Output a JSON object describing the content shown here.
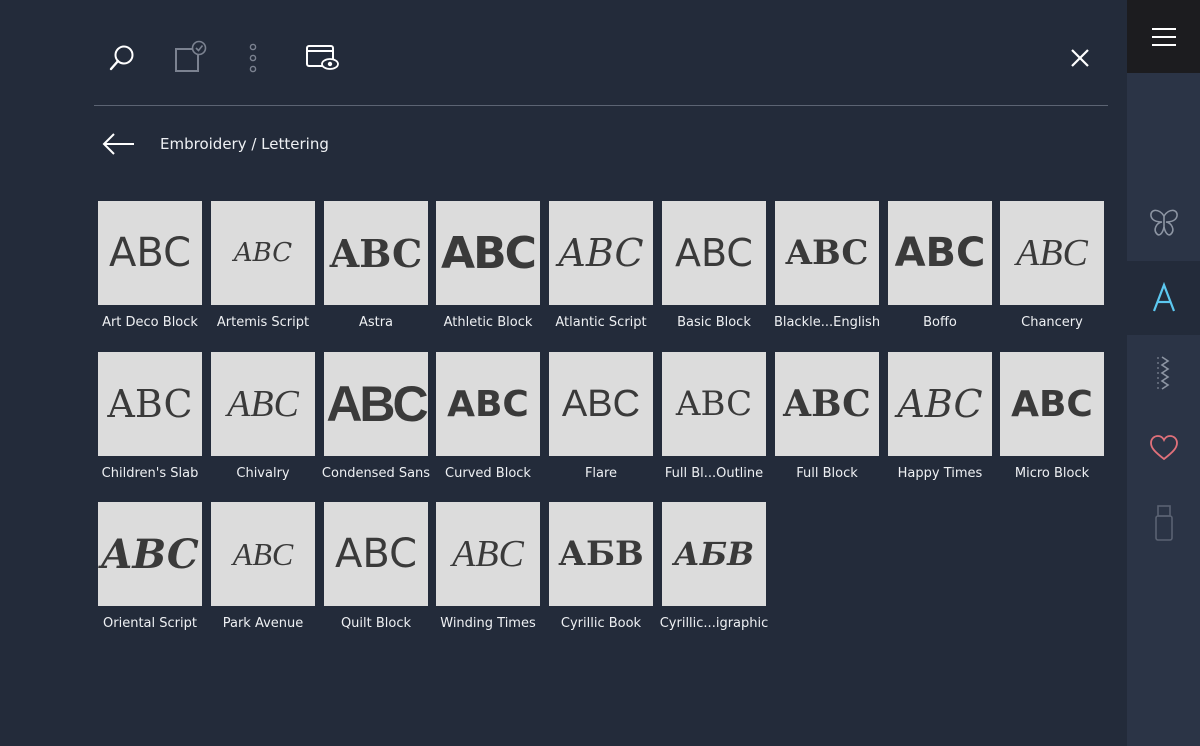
{
  "toolbar": {
    "icons": [
      "search-icon",
      "select-frame-icon",
      "more-vertical-icon",
      "preview-eye-icon",
      "close-icon"
    ]
  },
  "breadcrumb": {
    "text": "Embroidery / Lettering"
  },
  "fonts": [
    {
      "label": "Art Deco Block",
      "sample": "ABC"
    },
    {
      "label": "Artemis Script",
      "sample": "ABC"
    },
    {
      "label": "Astra",
      "sample": "ABC"
    },
    {
      "label": "Athletic Block",
      "sample": "ABC"
    },
    {
      "label": "Atlantic Script",
      "sample": "ABC"
    },
    {
      "label": "Basic Block",
      "sample": "ABC"
    },
    {
      "label": "Blackle...English",
      "sample": "ABC"
    },
    {
      "label": "Boffo",
      "sample": "ABC"
    },
    {
      "label": "Chancery",
      "sample": "ABC"
    },
    {
      "label": "Children's Slab",
      "sample": "ABC"
    },
    {
      "label": "Chivalry",
      "sample": "ABC"
    },
    {
      "label": "Condensed Sans",
      "sample": "ABC"
    },
    {
      "label": "Curved Block",
      "sample": "ABC"
    },
    {
      "label": "Flare",
      "sample": "ABC"
    },
    {
      "label": "Full Bl...Outline",
      "sample": "ABC"
    },
    {
      "label": "Full Block",
      "sample": "ABC"
    },
    {
      "label": "Happy Times",
      "sample": "ABC"
    },
    {
      "label": "Micro Block",
      "sample": "ABC"
    },
    {
      "label": "Oriental Script",
      "sample": "ABC"
    },
    {
      "label": "Park Avenue",
      "sample": "ABC"
    },
    {
      "label": "Quilt Block",
      "sample": "ABC"
    },
    {
      "label": "Winding Times",
      "sample": "ABC"
    },
    {
      "label": "Cyrillic Book",
      "sample": "АБВ"
    },
    {
      "label": "Cyrillic...igraphic",
      "sample": "АБВ"
    }
  ],
  "rail": {
    "menu_icon": "hamburger-menu-icon",
    "items": [
      {
        "icon": "butterfly-design-icon",
        "active": false
      },
      {
        "icon": "lettering-a-icon",
        "active": true
      },
      {
        "icon": "stitch-zigzag-icon",
        "active": false
      },
      {
        "icon": "favorites-heart-icon",
        "active": false
      },
      {
        "icon": "usb-stick-icon",
        "active": false
      }
    ]
  },
  "colors": {
    "background": "#232b3a",
    "rail": "#2b3446",
    "accent": "#5cc8f0",
    "heart": "#e0707a",
    "swatch": "#dcdcdc"
  }
}
